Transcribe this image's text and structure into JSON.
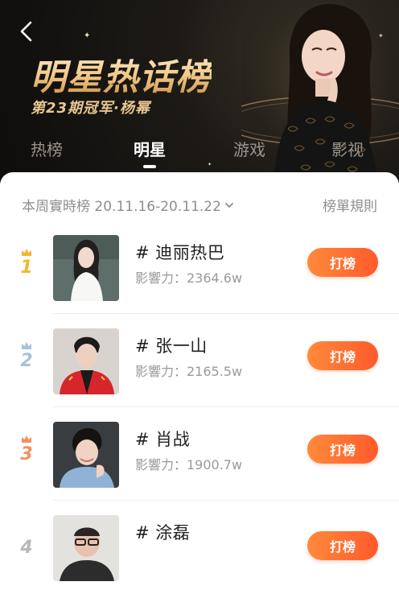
{
  "header": {
    "title": "明星热话榜",
    "subtitle": "第23期冠军·杨幂",
    "tabs": [
      "热榜",
      "明星",
      "游戏",
      "影视"
    ],
    "active_tab_index": 1
  },
  "board": {
    "period_label": "本周實時榜 20.11.16-20.11.22",
    "rules_label": "榜單規則",
    "entries": [
      {
        "rank": "1",
        "name": "# 迪丽热巴",
        "influence": "影響力：2364.6w",
        "button": "打榜",
        "rank_color": "#f2b632"
      },
      {
        "rank": "2",
        "name": "# 张一山",
        "influence": "影響力：2165.5w",
        "button": "打榜",
        "rank_color": "#a9bfe0"
      },
      {
        "rank": "3",
        "name": "# 肖战",
        "influence": "影響力：1900.7w",
        "button": "打榜",
        "rank_color": "#f09060"
      },
      {
        "rank": "4",
        "name": "# 涂磊",
        "influence": "",
        "button": "打榜",
        "rank_color": "#b8b8b8"
      }
    ]
  },
  "colors": {
    "accent": "#ff6a30",
    "title_gold": "#f0c784",
    "hero_bg": "#15130f"
  }
}
